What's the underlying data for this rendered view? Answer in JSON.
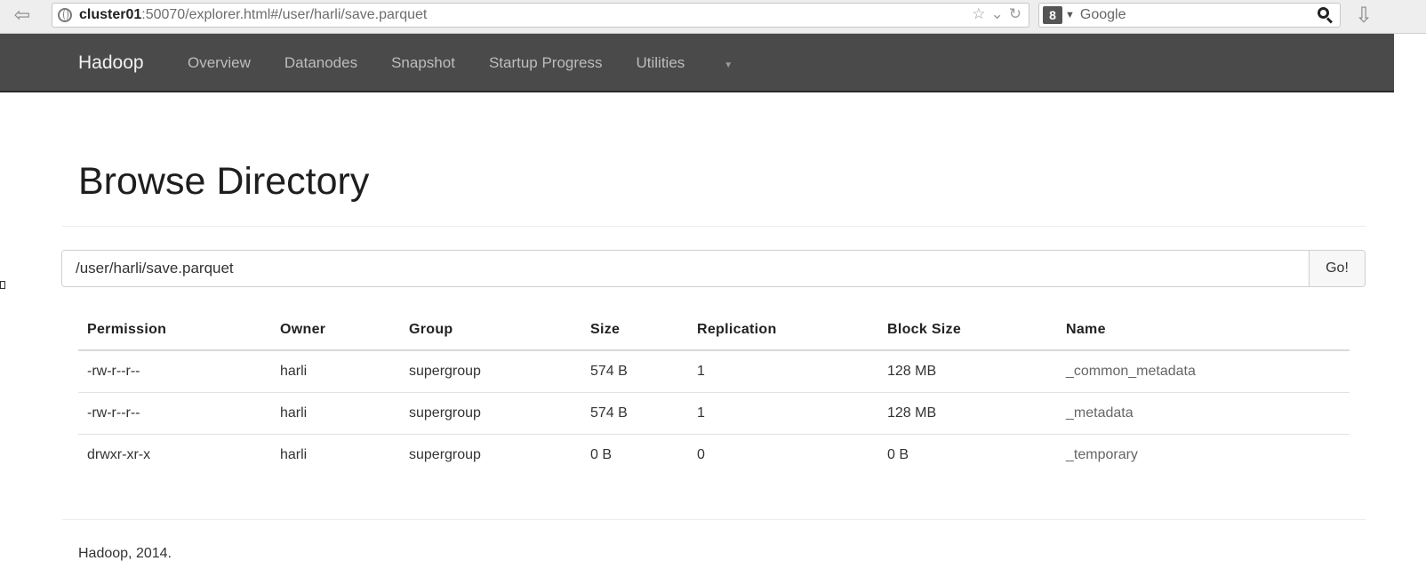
{
  "browser": {
    "url_host": "cluster01",
    "url_rest": ":50070/explorer.html#/user/harli/save.parquet",
    "search_engine": "Google"
  },
  "navbar": {
    "brand": "Hadoop",
    "items": [
      "Overview",
      "Datanodes",
      "Snapshot",
      "Startup Progress",
      "Utilities"
    ]
  },
  "main": {
    "title": "Browse Directory",
    "path_value": "/user/harli/save.parquet",
    "go_label": "Go!",
    "columns": [
      "Permission",
      "Owner",
      "Group",
      "Size",
      "Replication",
      "Block Size",
      "Name"
    ],
    "rows": [
      [
        "-rw-r--r--",
        "harli",
        "supergroup",
        "574 B",
        "1",
        "128 MB",
        "_common_metadata"
      ],
      [
        "-rw-r--r--",
        "harli",
        "supergroup",
        "574 B",
        "1",
        "128 MB",
        "_metadata"
      ],
      [
        "drwxr-xr-x",
        "harli",
        "supergroup",
        "0 B",
        "0",
        "0 B",
        "_temporary"
      ]
    ]
  },
  "footer": {
    "text": "Hadoop, 2014."
  }
}
